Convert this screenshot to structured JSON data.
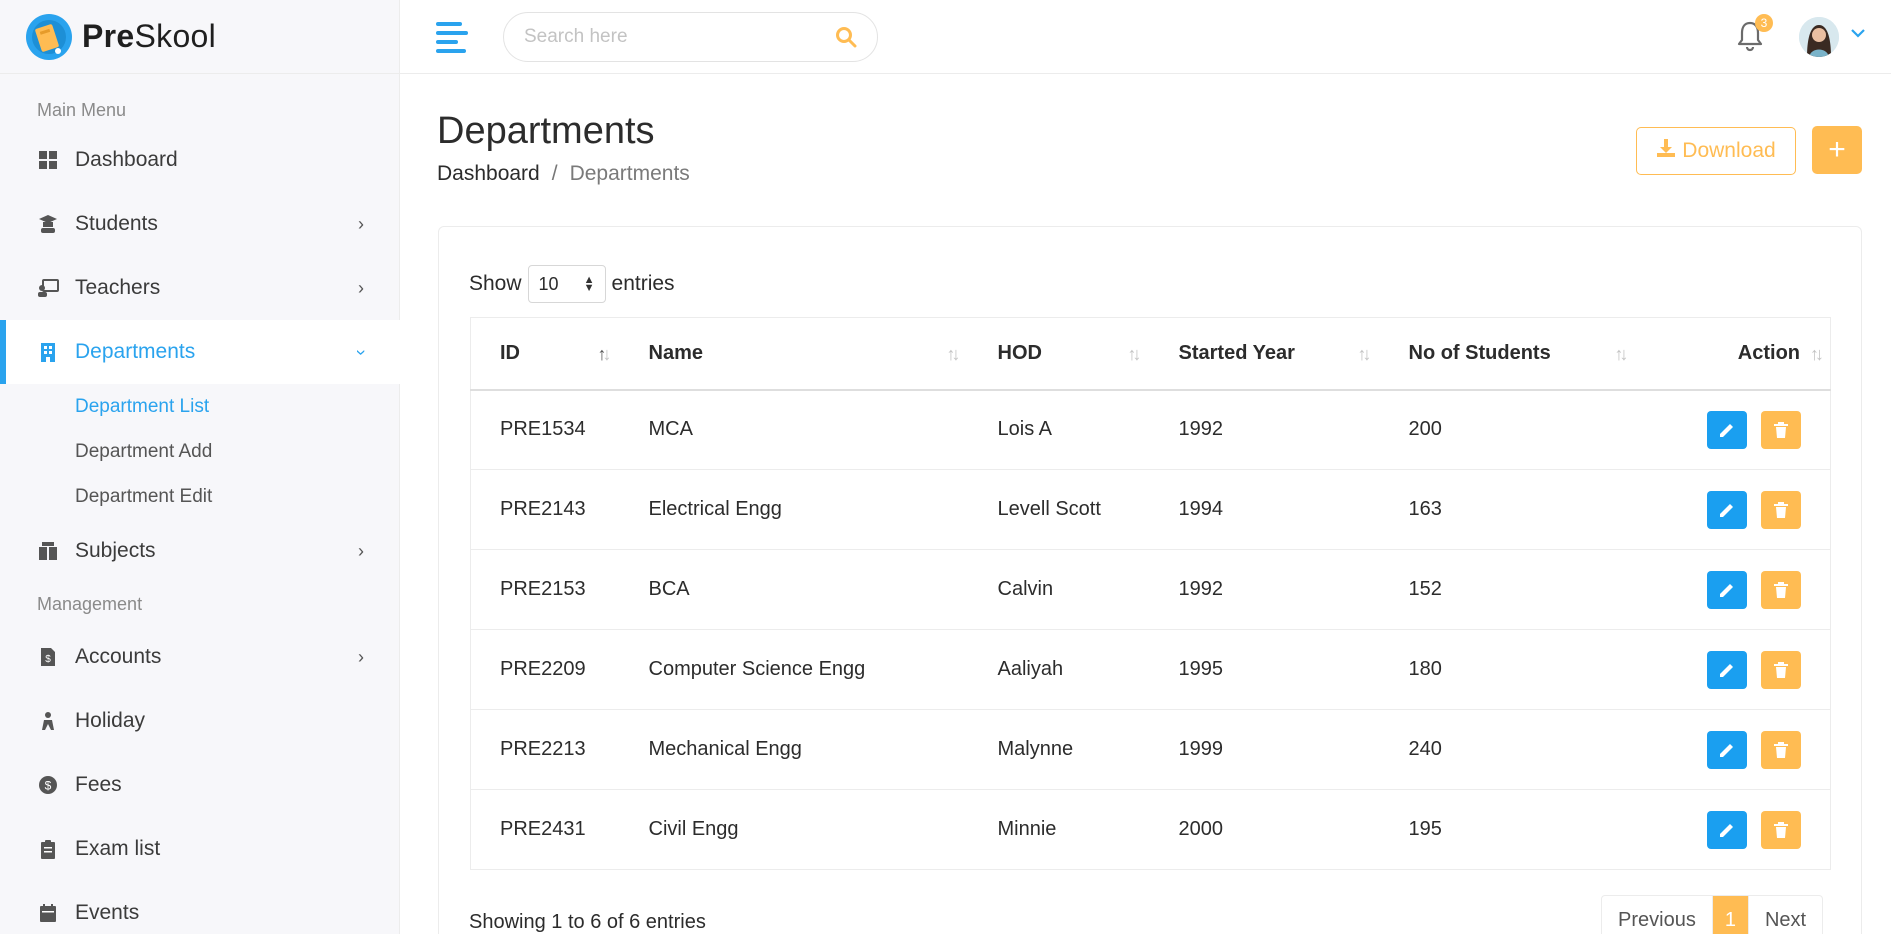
{
  "brand": {
    "name_bold": "Pre",
    "name_rest": "Skool"
  },
  "sidebar": {
    "heading_main": "Main Menu",
    "heading_management": "Management",
    "items": [
      {
        "label": "Dashboard",
        "icon": "dashboard-icon"
      },
      {
        "label": "Students",
        "icon": "graduate-icon"
      },
      {
        "label": "Teachers",
        "icon": "teacher-icon"
      },
      {
        "label": "Departments",
        "icon": "building-icon"
      },
      {
        "label": "Subjects",
        "icon": "book-icon"
      },
      {
        "label": "Accounts",
        "icon": "invoice-icon"
      },
      {
        "label": "Holiday",
        "icon": "holiday-icon"
      },
      {
        "label": "Fees",
        "icon": "fees-icon"
      },
      {
        "label": "Exam list",
        "icon": "clipboard-icon"
      },
      {
        "label": "Events",
        "icon": "calendar-icon"
      }
    ],
    "submenu": [
      "Department List",
      "Department Add",
      "Department Edit"
    ]
  },
  "header": {
    "search_placeholder": "Search here",
    "notification_count": "3"
  },
  "page": {
    "title": "Departments",
    "breadcrumb": [
      "Dashboard",
      "Departments"
    ],
    "download_label": "Download",
    "add_label": "+"
  },
  "table": {
    "show_label": "Show",
    "entries_label": "entries",
    "page_size": "10",
    "columns": [
      "ID",
      "Name",
      "HOD",
      "Started Year",
      "No of Students",
      "Action"
    ],
    "rows": [
      {
        "id": "PRE1534",
        "name": "MCA",
        "hod": "Lois A",
        "year": "1992",
        "students": "200"
      },
      {
        "id": "PRE2143",
        "name": "Electrical Engg",
        "hod": "Levell Scott",
        "year": "1994",
        "students": "163"
      },
      {
        "id": "PRE2153",
        "name": "BCA",
        "hod": "Calvin",
        "year": "1992",
        "students": "152"
      },
      {
        "id": "PRE2209",
        "name": "Computer Science Engg",
        "hod": "Aaliyah",
        "year": "1995",
        "students": "180"
      },
      {
        "id": "PRE2213",
        "name": "Mechanical Engg",
        "hod": "Malynne",
        "year": "1999",
        "students": "240"
      },
      {
        "id": "PRE2431",
        "name": "Civil Engg",
        "hod": "Minnie",
        "year": "2000",
        "students": "195"
      }
    ],
    "showing_text": "Showing 1 to 6 of 6 entries",
    "pagination": {
      "previous": "Previous",
      "current": "1",
      "next": "Next"
    }
  },
  "colors": {
    "primary": "#2aa3ee",
    "accent": "#ffbc53"
  }
}
